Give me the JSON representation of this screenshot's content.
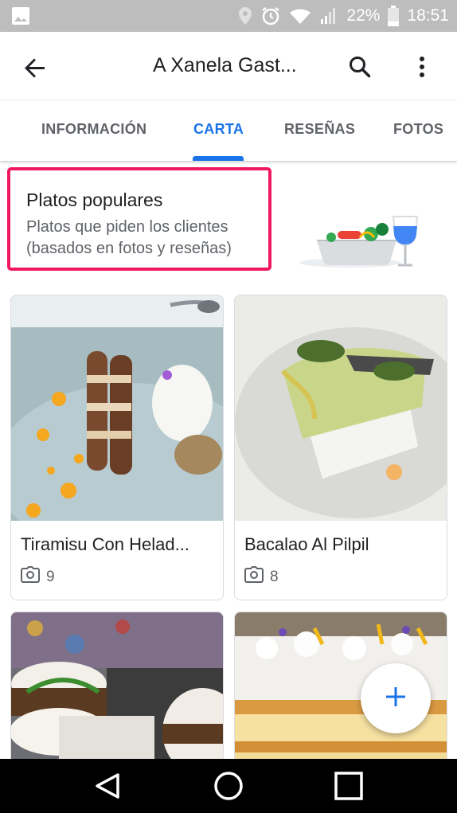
{
  "status_bar": {
    "battery_percent": "22%",
    "time": "18:51",
    "icons": [
      "image-icon",
      "location-icon",
      "alarm-icon",
      "wifi-icon",
      "signal-icon",
      "battery-icon"
    ]
  },
  "app_bar": {
    "title": "A Xanela Gast...",
    "icons": [
      "back-arrow-icon",
      "search-icon",
      "more-vert-icon"
    ]
  },
  "tabs": [
    {
      "label": "INFORMACIÓN",
      "active": false
    },
    {
      "label": "CARTA",
      "active": true
    },
    {
      "label": "RESEÑAS",
      "active": false
    },
    {
      "label": "FOTOS",
      "active": false
    }
  ],
  "popular": {
    "title": "Platos populares",
    "subtitle_line1": "Platos que piden los clientes",
    "subtitle_line2": "(basados en fotos y reseñas)"
  },
  "dishes": [
    {
      "name": "Tiramisu Con Helad...",
      "photo_count": "9"
    },
    {
      "name": "Bacalao Al Pilpil",
      "photo_count": "8"
    },
    {
      "name": "",
      "photo_count": ""
    },
    {
      "name": "",
      "photo_count": ""
    }
  ],
  "fab": {
    "icon": "plus-icon"
  },
  "colors": {
    "accent": "#1a73e8",
    "highlight_border": "#f0185f",
    "status_bar": "#bdbdbd"
  },
  "nav_bar": {
    "icons": [
      "nav-back-icon",
      "nav-home-icon",
      "nav-recents-icon"
    ]
  }
}
